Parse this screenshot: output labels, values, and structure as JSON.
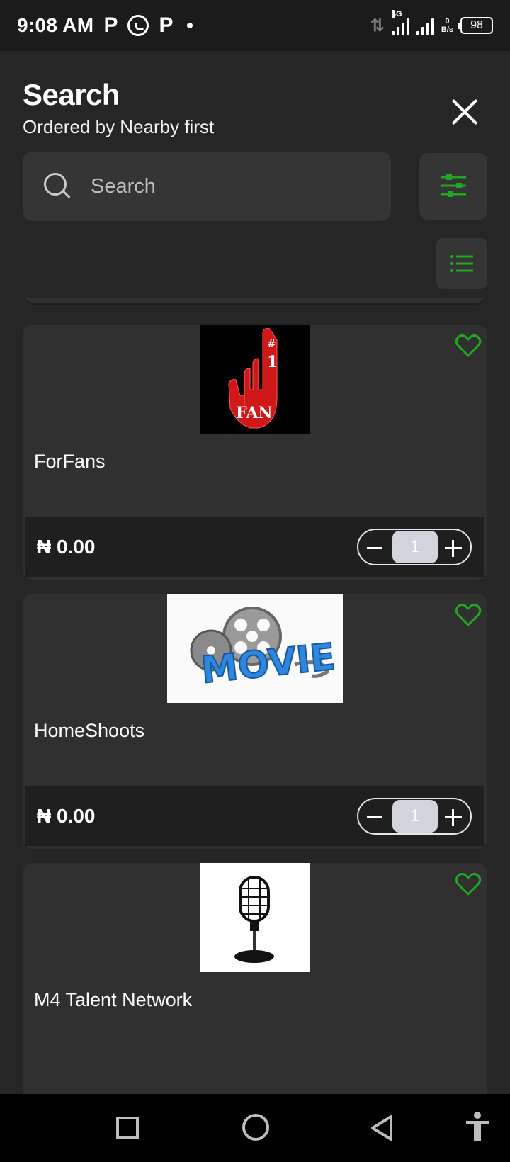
{
  "status": {
    "time": "9:08 AM",
    "net_type": "4G",
    "speed_value": "0",
    "speed_unit": "B/s",
    "battery": "98"
  },
  "header": {
    "title": "Search",
    "subtitle": "Ordered by Nearby first"
  },
  "search": {
    "placeholder": "Search"
  },
  "colors": {
    "accent": "#22a722",
    "background": "#262626",
    "card": "#303030"
  },
  "listings": [
    {
      "name": "ForFans",
      "price": "₦ 0.00",
      "quantity": "1",
      "image_label": "#1 FAN"
    },
    {
      "name": "HomeShoots",
      "price": "₦ 0.00",
      "quantity": "1",
      "image_label": "MOVIE"
    },
    {
      "name": "M4 Talent Network",
      "image": "microphone"
    }
  ]
}
